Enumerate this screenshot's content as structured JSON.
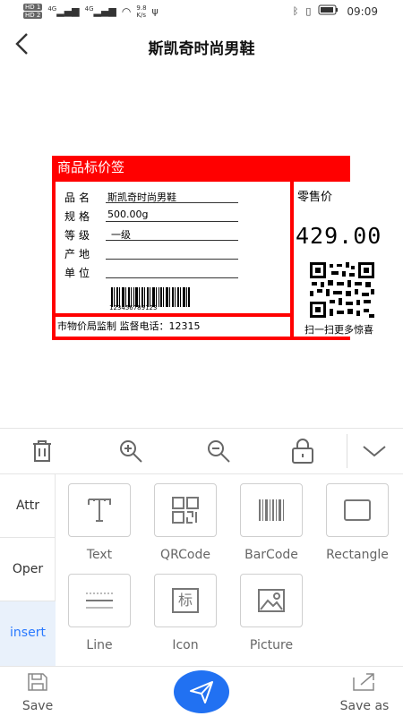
{
  "status": {
    "hd1": "HD 1",
    "hd2": "HD 2",
    "sig1": "4G",
    "sig2": "4G",
    "speed": "9.8",
    "speed_unit": "K/s",
    "time": "09:09"
  },
  "nav": {
    "title": "斯凯奇时尚男鞋"
  },
  "label": {
    "header": "商品标价签",
    "rows": [
      {
        "key": "品名",
        "value": "斯凯奇时尚男鞋"
      },
      {
        "key": "规格",
        "value": "500.00g"
      },
      {
        "key": "等级",
        "value": "一级"
      },
      {
        "key": "产地",
        "value": ""
      },
      {
        "key": "单位",
        "value": ""
      }
    ],
    "barcode_number": "123456789123",
    "bottom": "市物价局监制 监督电话：12315",
    "retail_title": "零售价",
    "price": "429.00",
    "scan_text": "扫一扫更多惊喜"
  },
  "side_tabs": [
    "Attr",
    "Oper",
    "insert"
  ],
  "tools": [
    "Text",
    "QRCode",
    "BarCode",
    "Rectangle",
    "Line",
    "Icon",
    "Picture"
  ],
  "icon_tool_glyph": "标",
  "bottom": {
    "save": "Save",
    "save_as": "Save as"
  },
  "colors": {
    "label_red": "#ff0000",
    "accent_blue": "#2171f2",
    "active_tab_bg": "#e9f1fb"
  }
}
